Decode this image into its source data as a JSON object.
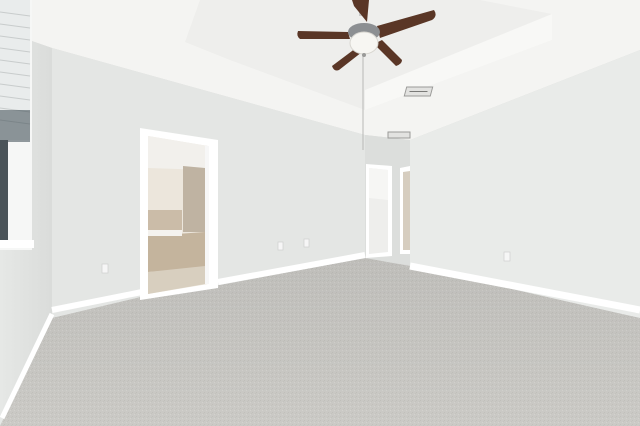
{
  "scene": {
    "type": "photo",
    "subject": "empty-bedroom",
    "colors": {
      "ceiling": "#f4f4f2",
      "wall_left": "#eceeec",
      "wall_back": "#e4e6e4",
      "wall_right": "#e9ebe9",
      "carpet": "#cbcac6",
      "trim": "#ffffff",
      "fan_blade": "#5a3626",
      "bath_tile": "#c9b9a4"
    },
    "icons": [
      "ceiling-fan-icon",
      "air-vent-icon",
      "outlet-icon"
    ]
  }
}
